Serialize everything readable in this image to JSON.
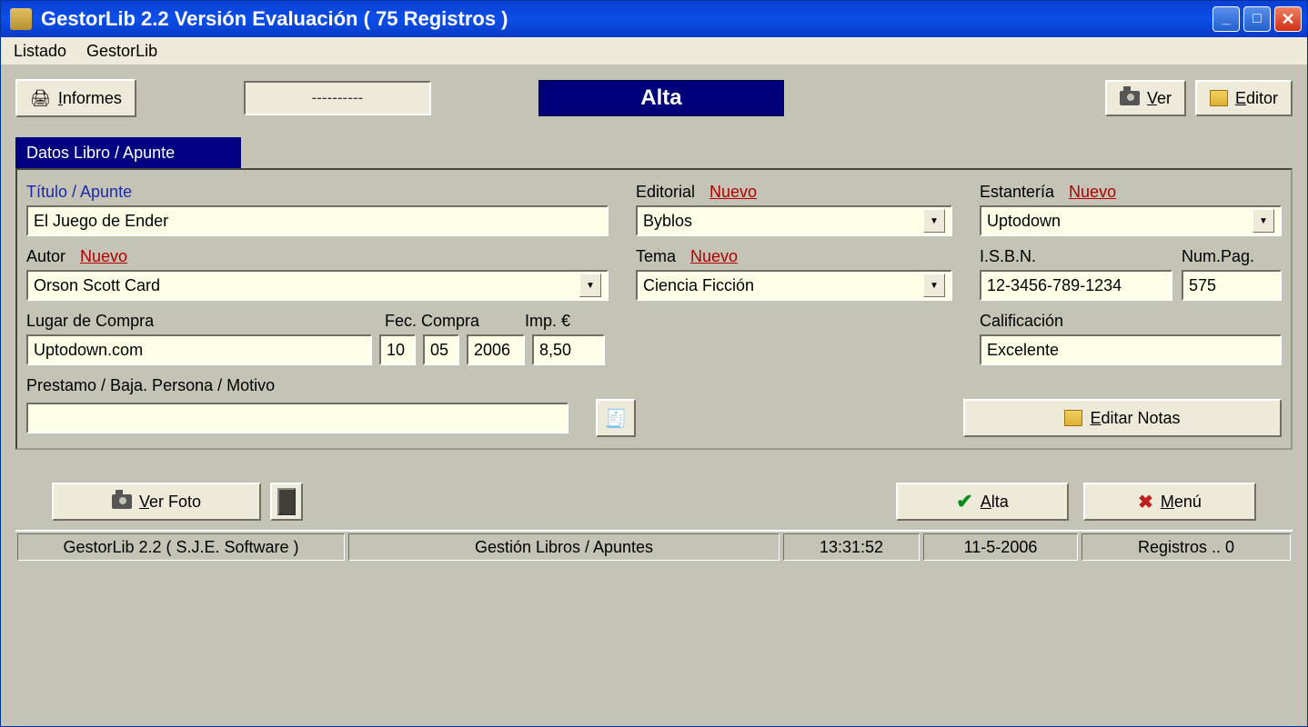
{
  "window": {
    "title": "GestorLib 2.2  Versión Evaluación ( 75 Registros )"
  },
  "menubar": {
    "items": [
      "Listado",
      "GestorLib"
    ]
  },
  "toolbar": {
    "informes": "Informes",
    "dashes": "----------",
    "mode": "Alta",
    "ver": "Ver",
    "editor": "Editor"
  },
  "tab": {
    "label": "Datos Libro / Apunte"
  },
  "labels": {
    "titulo": "Título / Apunte",
    "editorial": "Editorial",
    "estanteria": "Estantería",
    "autor": "Autor",
    "tema": "Tema",
    "isbn": "I.S.B.N.",
    "numpag": "Num.Pag.",
    "lugar": "Lugar de Compra",
    "feccompra": "Fec. Compra",
    "imp": "Imp.  €",
    "calificacion": "Calificación",
    "prestamo": "Prestamo / Baja.   Persona / Motivo",
    "nuevo": "Nuevo"
  },
  "form": {
    "titulo": "El Juego de Ender",
    "editorial": "Byblos",
    "estanteria": "Uptodown",
    "autor": "Orson Scott Card",
    "tema": "Ciencia Ficción",
    "isbn": "12-3456-789-1234",
    "numpag": "575",
    "lugar": "Uptodown.com",
    "fec_dd": "10",
    "fec_mm": "05",
    "fec_yyyy": "2006",
    "imp": "8,50",
    "calificacion": "Excelente",
    "prestamo": ""
  },
  "buttons": {
    "editar_notas": "Editar Notas",
    "ver_foto": "Ver Foto",
    "alta": "Alta",
    "menu": "Menú"
  },
  "status": {
    "app": "GestorLib 2.2  ( S.J.E. Software )",
    "center": "Gestión Libros / Apuntes",
    "time": "13:31:52",
    "date": "11-5-2006",
    "registros": "Registros ..  0"
  }
}
